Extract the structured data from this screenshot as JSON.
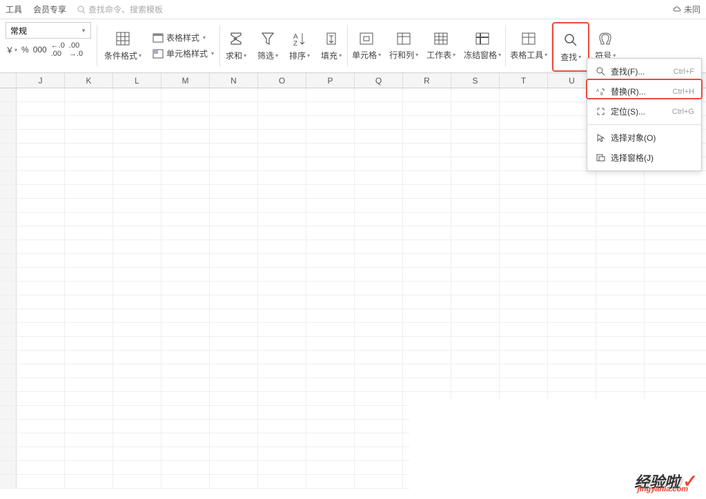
{
  "topbar": {
    "tools": "工具",
    "member": "会员专享",
    "search_placeholder": "查找命令、搜索模板",
    "cloud": "未同"
  },
  "ribbon": {
    "format_name": "常规",
    "currency": "￥",
    "percent": "%",
    "thousands": "000",
    "dec_inc": "⁺.0₀",
    "dec_dec": ".00₋",
    "cond_format": "条件格式",
    "table_style": "表格样式",
    "cell_style": "单元格样式",
    "sum": "求和",
    "filter": "筛选",
    "sort": "排序",
    "fill": "填充",
    "cell": "单元格",
    "rowcol": "行和列",
    "sheet": "工作表",
    "freeze": "冻结窗格",
    "table_tools": "表格工具",
    "find": "查找",
    "symbol": "符号"
  },
  "menu": {
    "find": "查找(F)...",
    "find_key": "Ctrl+F",
    "replace": "替换(R)...",
    "replace_key": "Ctrl+H",
    "goto": "定位(S)...",
    "goto_key": "Ctrl+G",
    "select_obj": "选择对象(O)",
    "select_pane": "选择窗格(J)"
  },
  "columns": [
    "",
    "J",
    "K",
    "L",
    "M",
    "N",
    "O",
    "P",
    "Q",
    "R",
    "S",
    "T",
    "U",
    ""
  ],
  "watermark": {
    "main": "经验啦",
    "sub": "jingyanla.com"
  }
}
